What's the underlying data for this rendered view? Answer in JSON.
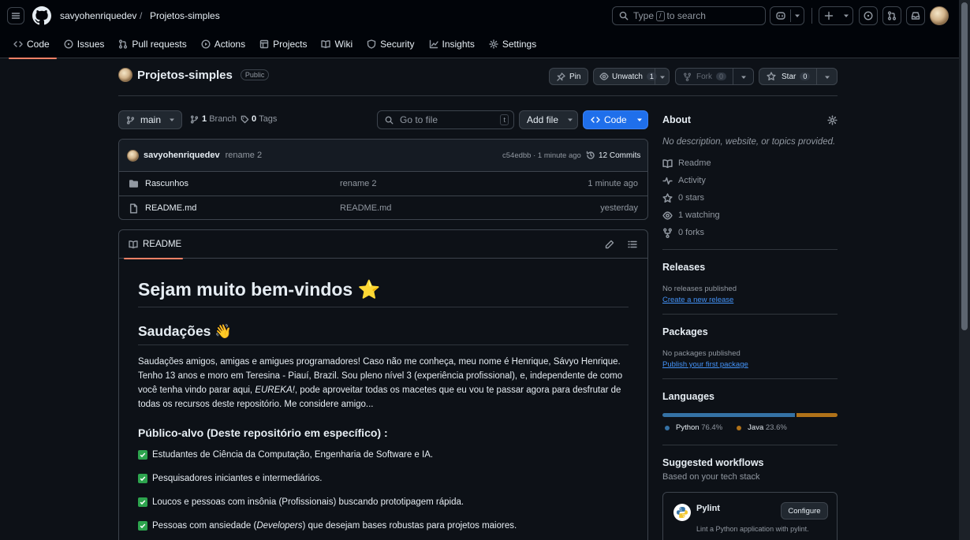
{
  "header": {
    "owner": "savyohenriquedev",
    "separator": "/",
    "repo": "Projetos-simples",
    "search": {
      "prefix": "Type",
      "key": "/",
      "suffix": "to search"
    }
  },
  "nav": [
    {
      "label": "Code",
      "icon": "code-icon",
      "active": true
    },
    {
      "label": "Issues",
      "icon": "issue-icon"
    },
    {
      "label": "Pull requests",
      "icon": "pull-request-icon"
    },
    {
      "label": "Actions",
      "icon": "play-icon"
    },
    {
      "label": "Projects",
      "icon": "table-icon"
    },
    {
      "label": "Wiki",
      "icon": "book-icon"
    },
    {
      "label": "Security",
      "icon": "shield-icon"
    },
    {
      "label": "Insights",
      "icon": "graph-icon"
    },
    {
      "label": "Settings",
      "icon": "gear-icon"
    }
  ],
  "repo_header": {
    "name": "Projetos-simples",
    "visibility": "Public",
    "pin": "Pin",
    "unwatch": "Unwatch",
    "watch_count": "1",
    "fork": "Fork",
    "fork_count": "0",
    "star": "Star",
    "star_count": "0"
  },
  "toolbar": {
    "branch": "main",
    "branches_count": "1",
    "branches_label": "Branch",
    "tags_count": "0",
    "tags_label": "Tags",
    "goto_placeholder": "Go to file",
    "goto_key": "t",
    "add_file": "Add file",
    "code": "Code"
  },
  "commit": {
    "author": "savyohenriquedev",
    "message": "rename 2",
    "hash_time": "c54edbb · 1 minute ago",
    "commits": "12 Commits"
  },
  "files": [
    {
      "name": "Rascunhos",
      "type": "folder",
      "message": "rename 2",
      "time": "1 minute ago"
    },
    {
      "name": "README.md",
      "type": "file",
      "message": "README.md",
      "time": "yesterday"
    }
  ],
  "readme": {
    "tab": "README",
    "h1": "Sejam muito bem-vindos ⭐",
    "h2": "Saudações 👋",
    "para_start": "Saudações amigos, amigas e amigues programadores! Caso não me conheça, meu nome é Henrique, Sávyo Henrique. Tenho 13 anos e moro em Teresina - Piauí, Brazil. Sou pleno nível 3 (experiência profissional), e, independente de como você tenha vindo parar aqui, ",
    "para_em": "EUREKA!",
    "para_end": ", pode aproveitar todas os macetes que eu vou te passar agora para desfrutar de todas os recursos deste repositório. Me considere amigo...",
    "h3": "Público-alvo (Deste repositório em específico) :",
    "items": [
      "Estudantes de Ciência da Computação, Engenharia de Software e IA.",
      "Pesquisadores iniciantes e intermediários.",
      "Loucos e pessoas com insônia (Profissionais) buscando prototipagem rápida."
    ],
    "item4_start": "Pessoas com ansiedade (",
    "item4_em": "Developers",
    "item4_end": ") que desejam bases robustas para projetos maiores."
  },
  "about": {
    "title": "About",
    "description": "No description, website, or topics provided.",
    "links": [
      {
        "label": "Readme",
        "icon": "book-icon"
      },
      {
        "label": "Activity",
        "icon": "pulse-icon"
      },
      {
        "label": "0 stars",
        "icon": "star-icon"
      },
      {
        "label": "1 watching",
        "icon": "eye-icon"
      },
      {
        "label": "0 forks",
        "icon": "fork-icon"
      }
    ]
  },
  "releases": {
    "title": "Releases",
    "text": "No releases published",
    "link": "Create a new release"
  },
  "packages": {
    "title": "Packages",
    "text": "No packages published",
    "link": "Publish your first package"
  },
  "languages": {
    "title": "Languages",
    "items": [
      {
        "name": "Python",
        "percent": "76.4%",
        "value": 76.4,
        "color": "#3572A5"
      },
      {
        "name": "Java",
        "percent": "23.6%",
        "value": 23.6,
        "color": "#b07219"
      }
    ]
  },
  "workflows": {
    "title": "Suggested workflows",
    "subtitle": "Based on your tech stack",
    "card": {
      "name": "Pylint",
      "button": "Configure",
      "description": "Lint a Python application with pylint."
    }
  }
}
